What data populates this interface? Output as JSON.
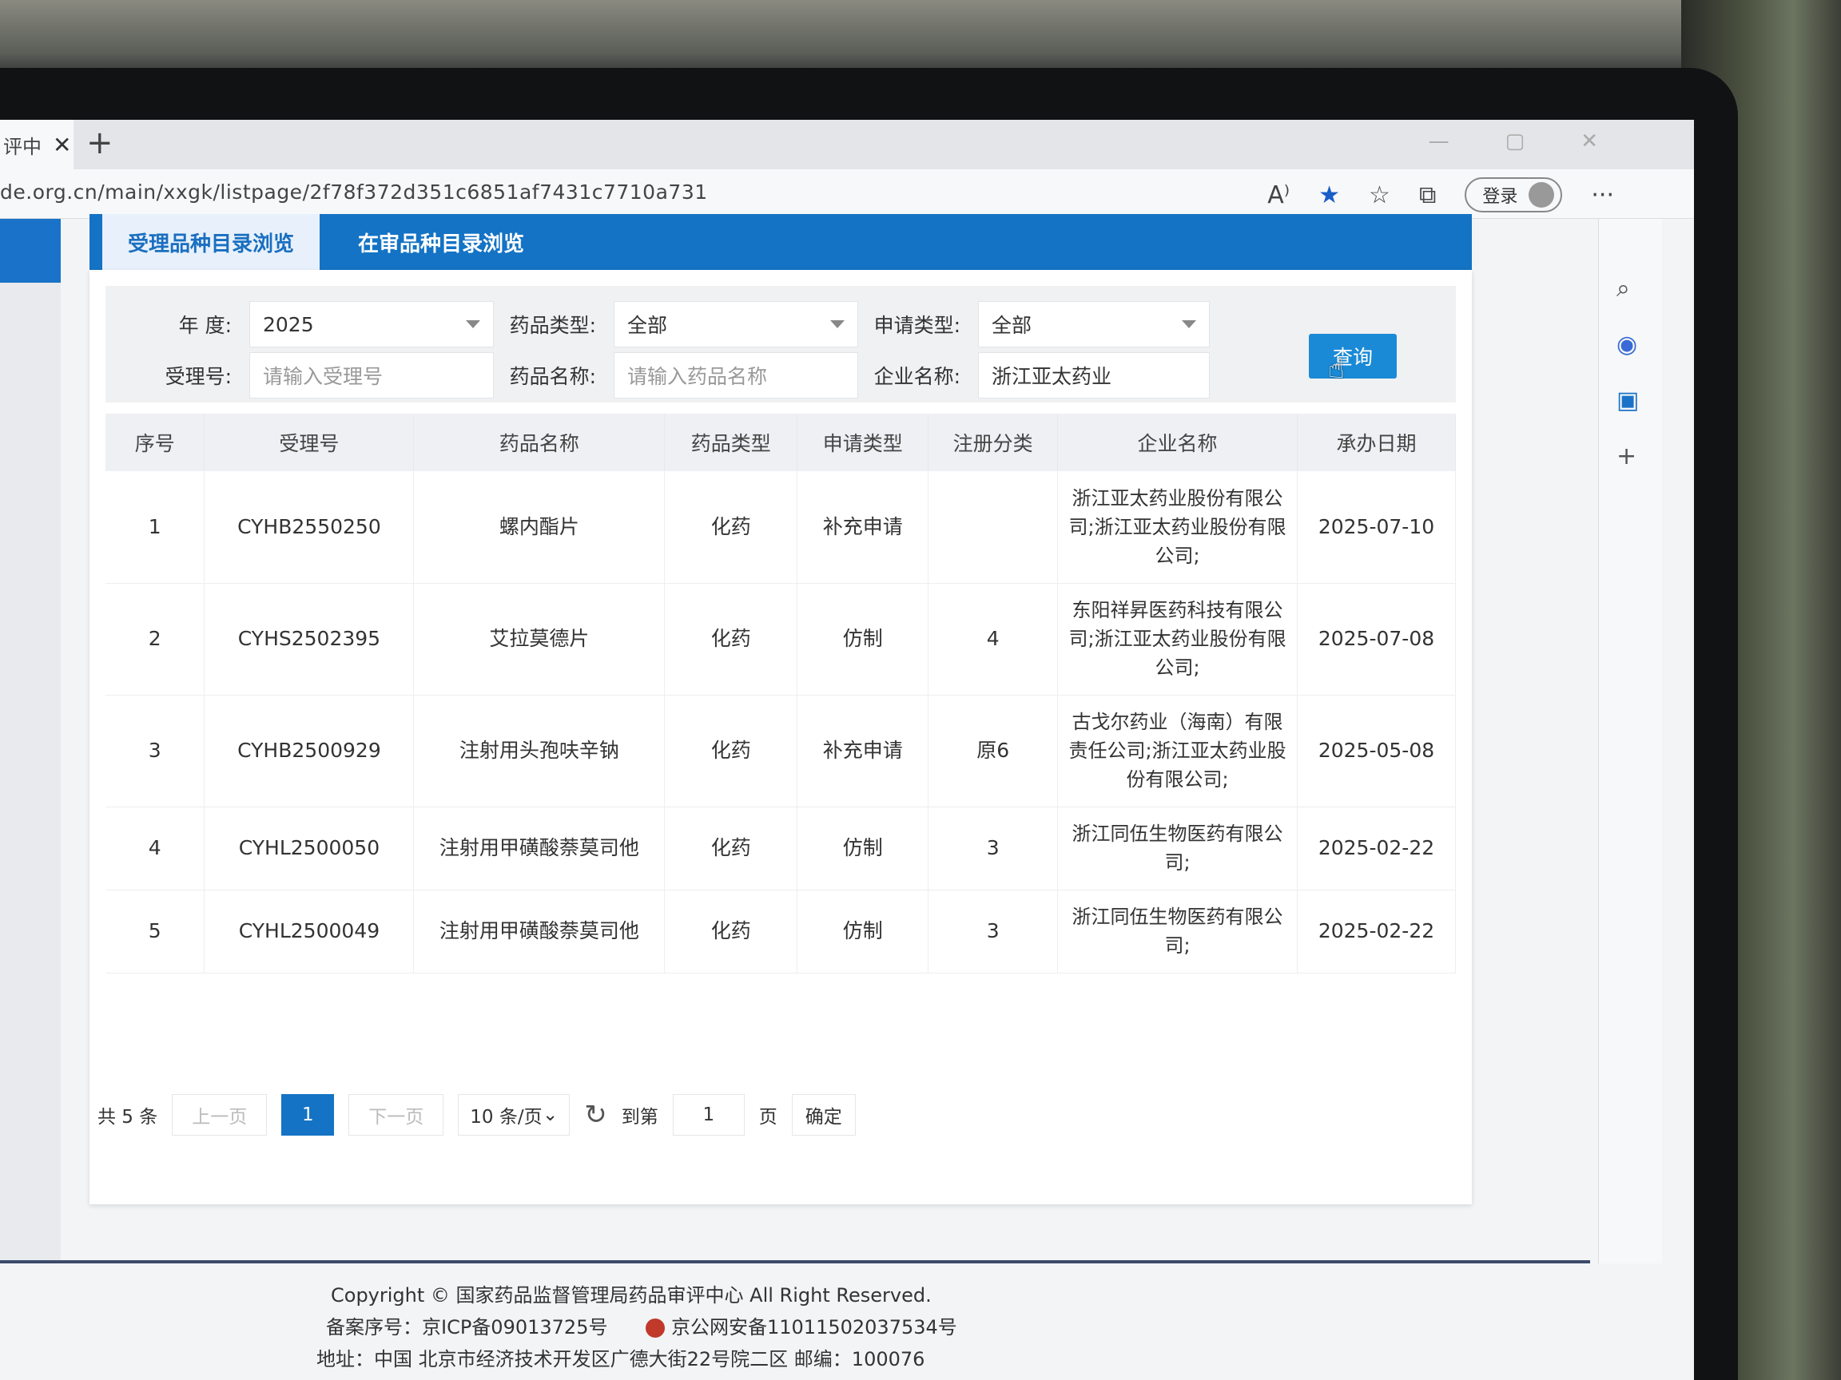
{
  "browser": {
    "tab_title": "评中",
    "tab_close": "✕",
    "new_tab": "+",
    "url": "de.org.cn/main/xxgk/listpage/2f78f372d351c6851af7431c7710a731",
    "read_aloud": "A⁾",
    "login_label": "登录",
    "more": "···",
    "win_min": "—",
    "win_max": "▢",
    "win_close": "✕"
  },
  "tabs": {
    "active": "受理品种目录浏览",
    "other": "在审品种目录浏览"
  },
  "filter": {
    "year_label": "年   度:",
    "year_value": "2025",
    "drug_type_label": "药品类型:",
    "drug_type_value": "全部",
    "apply_type_label": "申请类型:",
    "apply_type_value": "全部",
    "accept_no_label": "受理号:",
    "accept_no_placeholder": "请输入受理号",
    "drug_name_label": "药品名称:",
    "drug_name_placeholder": "请输入药品名称",
    "company_label": "企业名称:",
    "company_value": "浙江亚太药业",
    "query_button": "查询"
  },
  "table": {
    "headers": [
      "序号",
      "受理号",
      "药品名称",
      "药品类型",
      "申请类型",
      "注册分类",
      "企业名称",
      "承办日期"
    ],
    "rows": [
      {
        "no": "1",
        "accept_no": "CYHB2550250",
        "drug": "螺内酯片",
        "type": "化药",
        "apply": "补充申请",
        "reg": "",
        "company": "浙江亚太药业股份有限公司;浙江亚太药业股份有限公司;",
        "date": "2025-07-10"
      },
      {
        "no": "2",
        "accept_no": "CYHS2502395",
        "drug": "艾拉莫德片",
        "type": "化药",
        "apply": "仿制",
        "reg": "4",
        "company": "东阳祥昇医药科技有限公司;浙江亚太药业股份有限公司;",
        "date": "2025-07-08"
      },
      {
        "no": "3",
        "accept_no": "CYHB2500929",
        "drug": "注射用头孢呋辛钠",
        "type": "化药",
        "apply": "补充申请",
        "reg": "原6",
        "company": "古戈尔药业（海南）有限责任公司;浙江亚太药业股份有限公司;",
        "date": "2025-05-08"
      },
      {
        "no": "4",
        "accept_no": "CYHL2500050",
        "drug": "注射用甲磺酸萘莫司他",
        "type": "化药",
        "apply": "仿制",
        "reg": "3",
        "company": "浙江同伍生物医药有限公司;",
        "date": "2025-02-22"
      },
      {
        "no": "5",
        "accept_no": "CYHL2500049",
        "drug": "注射用甲磺酸萘莫司他",
        "type": "化药",
        "apply": "仿制",
        "reg": "3",
        "company": "浙江同伍生物医药有限公司;",
        "date": "2025-02-22"
      }
    ]
  },
  "pager": {
    "total": "共 5 条",
    "prev": "上一页",
    "current": "1",
    "next": "下一页",
    "page_size": "10 条/页",
    "goto_label": "到第",
    "goto_value": "1",
    "page_unit": "页",
    "confirm": "确定"
  },
  "footer": {
    "copyright": "Copyright © 国家药品监督管理局药品审评中心    All Right Reserved.",
    "icp": "备案序号：京ICP备09013725号",
    "police": "京公网安备11011502037534号",
    "address": "地址：中国 北京市经济技术开发区广德大街22号院二区      邮编：100076"
  },
  "icons": [
    "close-icon",
    "plus-icon",
    "read-aloud-icon",
    "star-icon",
    "favorites-icon",
    "collections-icon",
    "avatar-icon",
    "more-icon",
    "search-icon",
    "refresh-icon",
    "caret-down-icon",
    "pointer-cursor-icon",
    "police-badge-icon"
  ]
}
